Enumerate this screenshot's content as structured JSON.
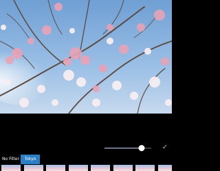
{
  "photo": {
    "subject": "cherry-blossom-photo"
  },
  "editor": {
    "intensity": 0.8,
    "confirm_icon": "checkmark-icon",
    "filters": [
      {
        "label": "No Filter",
        "selected": false
      },
      {
        "label": "Tokyo",
        "selected": true
      }
    ],
    "thumbnail_count": 9
  },
  "colors": {
    "accent": "#2b7fc7",
    "background": "#000000",
    "sky": "#8bb6e0",
    "blossom": "#e6a5b8"
  }
}
